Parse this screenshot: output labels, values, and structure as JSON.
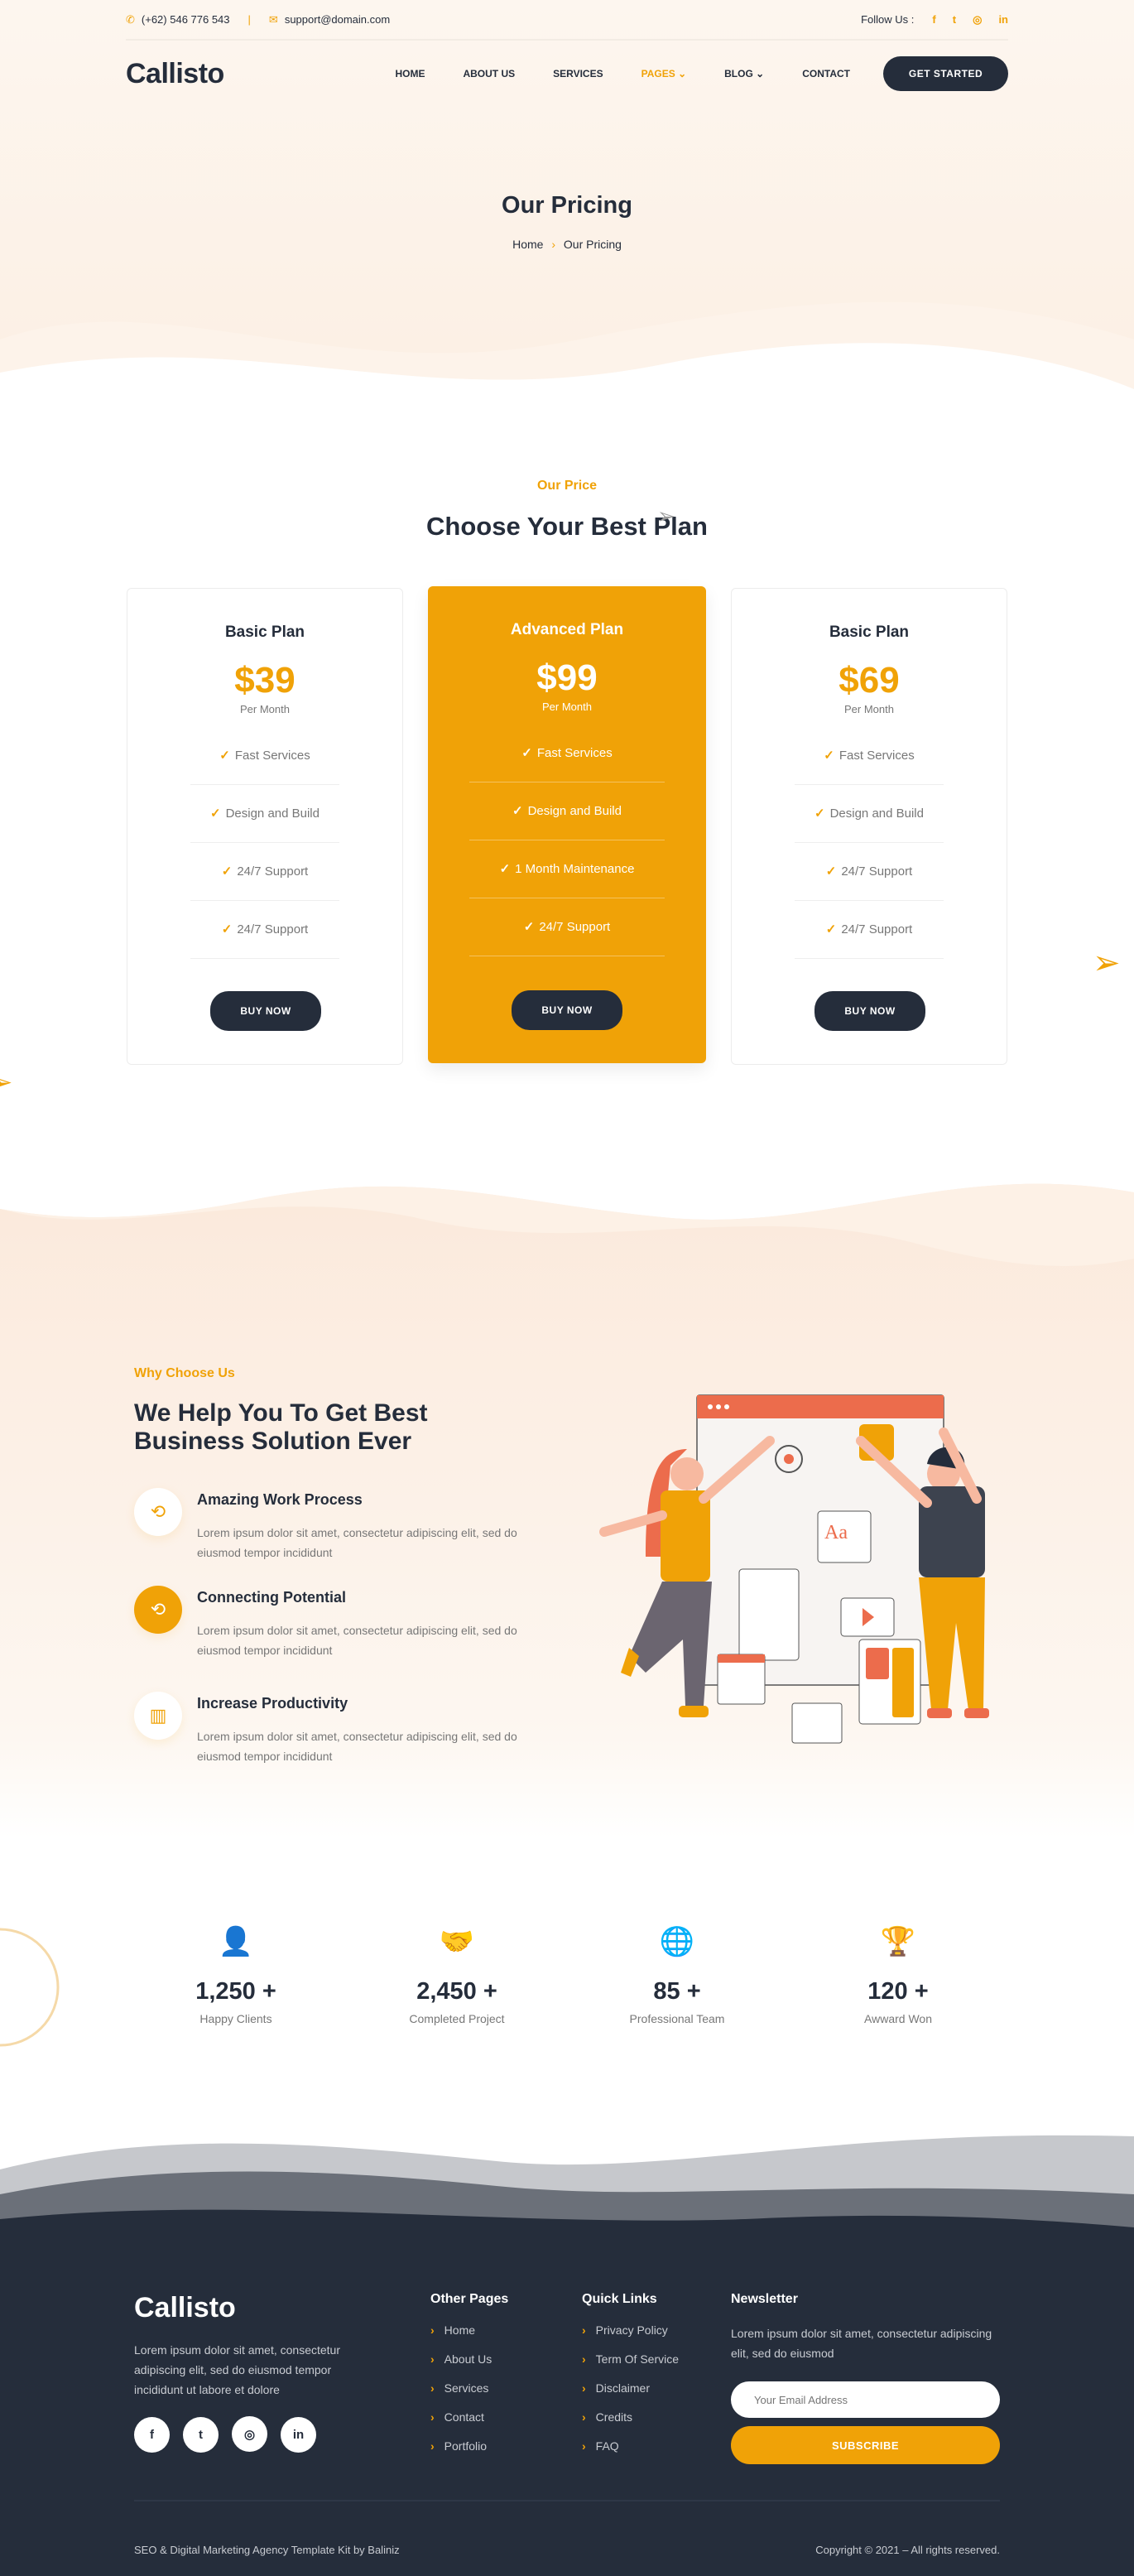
{
  "colors": {
    "accent": "#f0a207",
    "dark": "#252d3b"
  },
  "topbar": {
    "phone": "(+62) 546 776 543",
    "email": "support@domain.com",
    "follow_label": "Follow Us :",
    "social_icons": [
      "facebook-icon",
      "twitter-icon",
      "instagram-icon",
      "linkedin-icon"
    ]
  },
  "nav": {
    "logo": "Callisto",
    "items": [
      "HOME",
      "ABOUT US",
      "SERVICES",
      "PAGES",
      "BLOG",
      "CONTACT"
    ],
    "active": "PAGES",
    "cta": "GET STARTED"
  },
  "hero": {
    "title": "Our Pricing",
    "breadcrumb": {
      "home": "Home",
      "current": "Our Pricing"
    }
  },
  "pricing": {
    "eyebrow": "Our Price",
    "title": "Choose Your Best Plan",
    "plans": [
      {
        "name": "Basic Plan",
        "price": "$39",
        "period": "Per Month",
        "features": [
          "Fast Services",
          "Design and Build",
          "24/7 Support",
          "24/7 Support"
        ],
        "button": "BUY NOW"
      },
      {
        "name": "Advanced Plan",
        "price": "$99",
        "period": "Per Month",
        "features": [
          "Fast Services",
          "Design and Build",
          "1 Month Maintenance",
          "24/7 Support"
        ],
        "button": "BUY NOW",
        "featured": true
      },
      {
        "name": "Basic Plan",
        "price": "$69",
        "period": "Per Month",
        "features": [
          "Fast Services",
          "Design and Build",
          "24/7 Support",
          "24/7 Support"
        ],
        "button": "BUY NOW"
      }
    ]
  },
  "why": {
    "eyebrow": "Why Choose Us",
    "title_line1": "We Help You To Get Best",
    "title_line2": "Business Solution Ever",
    "items": [
      {
        "title": "Amazing Work Process",
        "text": "Lorem ipsum dolor sit amet, consectetur adipiscing elit, sed do eiusmod tempor incididunt"
      },
      {
        "title": "Connecting Potential",
        "text": "Lorem ipsum dolor sit amet, consectetur adipiscing elit, sed do eiusmod tempor incididunt"
      },
      {
        "title": "Increase Productivity",
        "text": "Lorem ipsum dolor sit amet, consectetur adipiscing elit, sed do eiusmod tempor incididunt"
      }
    ]
  },
  "stats": [
    {
      "value": "1,250 +",
      "label": "Happy Clients",
      "icon": "users-icon"
    },
    {
      "value": "2,450 +",
      "label": "Completed Project",
      "icon": "handshake-icon"
    },
    {
      "value": "85 +",
      "label": "Professional Team",
      "icon": "globe-team-icon"
    },
    {
      "value": "120 +",
      "label": "Awward Won",
      "icon": "trophy-icon"
    }
  ],
  "footer": {
    "logo": "Callisto",
    "about": "Lorem ipsum dolor sit amet, consectetur adipiscing elit, sed do eiusmod tempor incididunt ut labore et dolore",
    "other_pages": {
      "title": "Other Pages",
      "links": [
        "Home",
        "About Us",
        "Services",
        "Contact",
        "Portfolio"
      ]
    },
    "quick_links": {
      "title": "Quick Links",
      "links": [
        "Privacy Policy",
        "Term Of Service",
        "Disclaimer",
        "Credits",
        "FAQ"
      ]
    },
    "newsletter": {
      "title": "Newsletter",
      "text": "Lorem ipsum dolor sit amet, consectetur adipiscing elit, sed do eiusmod",
      "placeholder": "Your Email Address",
      "button": "SUBSCRIBE"
    },
    "credit": "SEO & Digital Marketing Agency Template Kit by Baliniz",
    "copyright": "Copyright © 2021 – All rights reserved."
  }
}
